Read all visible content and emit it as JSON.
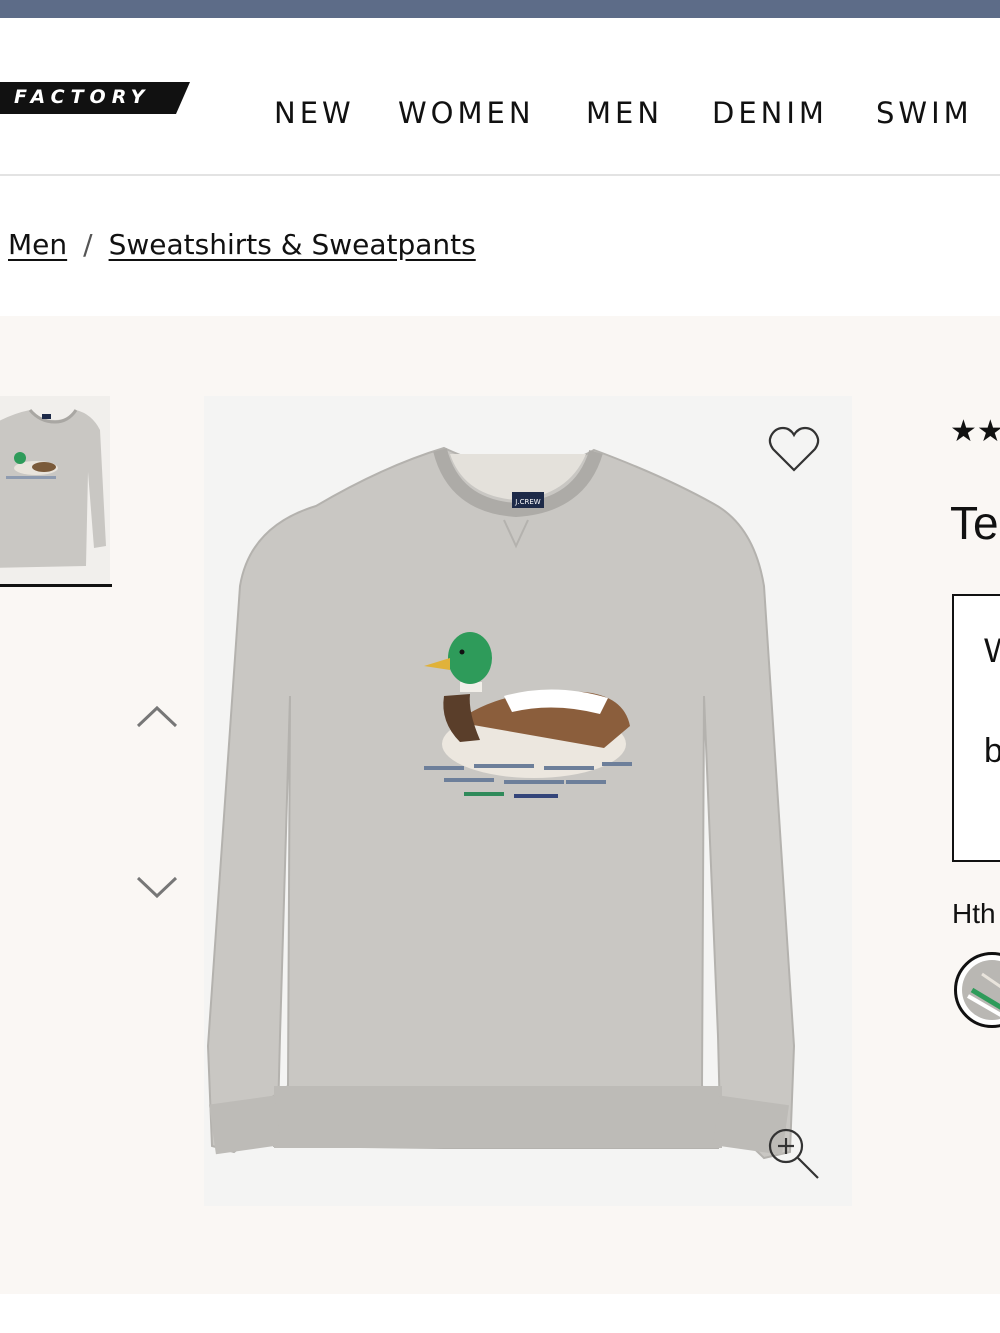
{
  "header": {
    "logo_text": "FACTORY",
    "nav": [
      {
        "label": "NEW"
      },
      {
        "label": "WOMEN"
      },
      {
        "label": "MEN"
      },
      {
        "label": "DENIM"
      },
      {
        "label": "SWIM"
      }
    ]
  },
  "breadcrumb": {
    "items": [
      "Men",
      "Sweatshirts & Sweatpants"
    ],
    "separator": "/"
  },
  "product": {
    "rating_visible": "★★",
    "title_visible": "Te",
    "promo_lines_visible": [
      "W",
      "b"
    ],
    "color_name_visible": "Hth",
    "label_tag_text": "J.CREW",
    "icons": {
      "wishlist": "heart-icon",
      "zoom": "zoom-in-icon",
      "prev": "chevron-up-icon",
      "next": "chevron-down-icon"
    }
  },
  "colors": {
    "top_bar": "#5d6c88",
    "product_bg": "#faf7f4",
    "sweatshirt": "#c9c7c3",
    "duck_head": "#2e9b5a"
  }
}
